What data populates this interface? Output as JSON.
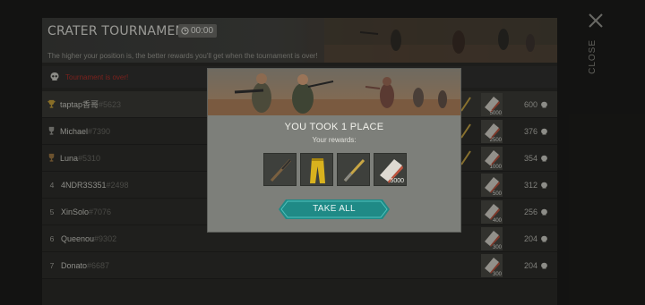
{
  "tournament": {
    "title": "CRATER TOURNAMENT",
    "timer": "00:00",
    "subtitle": "The higher your position is, the better rewards you'll get when the tournament is over!",
    "status": "Tournament is over!"
  },
  "close_label": "CLOSE",
  "leaderboard": [
    {
      "rank": "1",
      "name": "taptap香哥",
      "tag": "#5623",
      "reward": "5000",
      "score": "600"
    },
    {
      "rank": "2",
      "name": "Michael",
      "tag": "#7390",
      "reward": "2500",
      "score": "376"
    },
    {
      "rank": "3",
      "name": "Luna",
      "tag": "#5310",
      "reward": "1000",
      "score": "354"
    },
    {
      "rank": "4",
      "name": "4NDR3S351",
      "tag": "#2498",
      "reward": "500",
      "score": "312"
    },
    {
      "rank": "5",
      "name": "XinSolo",
      "tag": "#7076",
      "reward": "400",
      "score": "256"
    },
    {
      "rank": "6",
      "name": "Queenou",
      "tag": "#9302",
      "reward": "300",
      "score": "204"
    },
    {
      "rank": "7",
      "name": "Donato",
      "tag": "#6687",
      "reward": "300",
      "score": "204"
    }
  ],
  "modal": {
    "title": "YOU TOOK 1 PLACE",
    "subtitle": "Your rewards:",
    "rewards": [
      {
        "icon": "rifle-icon",
        "count": ""
      },
      {
        "icon": "yellow-pants-icon",
        "count": ""
      },
      {
        "icon": "syringe-rifle-icon",
        "count": ""
      },
      {
        "icon": "ammo-box-icon",
        "count": "5000"
      }
    ],
    "button": "TAKE ALL"
  },
  "colors": {
    "accent_teal": "#1f8a86",
    "loss_red": "#b3312b"
  }
}
